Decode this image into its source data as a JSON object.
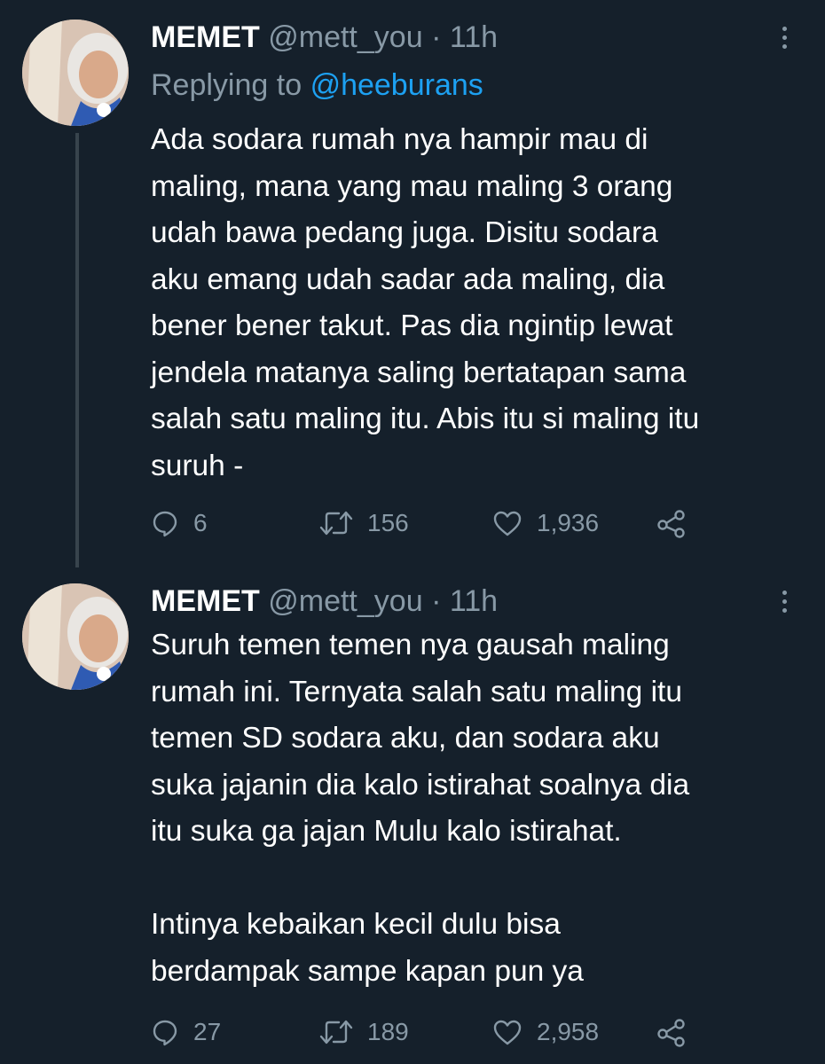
{
  "tweets": [
    {
      "name": "MEMET",
      "handle": "@mett_you",
      "separator": "·",
      "time": "11h",
      "replying_prefix": "Replying to",
      "replying_to": "@heeburans",
      "text": "Ada sodara rumah nya hampir mau di\nmaling, mana yang mau maling 3 orang\nudah bawa pedang juga. Disitu sodara\naku emang udah sadar ada maling, dia\nbener bener takut. Pas dia ngintip lewat\njendela matanya saling bertatapan sama\nsalah satu maling itu. Abis itu si maling itu\nsuruh -",
      "replies": "6",
      "retweets": "156",
      "likes": "1,936"
    },
    {
      "name": "MEMET",
      "handle": "@mett_you",
      "separator": "·",
      "time": "11h",
      "text": "Suruh temen temen nya gausah maling\nrumah ini. Ternyata salah satu maling itu\ntemen SD sodara aku, dan sodara aku\nsuka jajanin dia kalo istirahat soalnya dia\nitu suka ga jajan Mulu kalo istirahat.\n\nIntinya kebaikan kecil dulu bisa\nberdampak sampe kapan pun ya",
      "replies": "27",
      "retweets": "189",
      "likes": "2,958"
    }
  ],
  "colors": {
    "background": "#15202b",
    "text_primary": "#ffffff",
    "text_secondary": "#8899a6",
    "link": "#1da1f2",
    "thread_line": "#38444d"
  },
  "icons": [
    "more-vertical-icon",
    "reply-icon",
    "retweet-icon",
    "like-icon",
    "share-icon"
  ]
}
